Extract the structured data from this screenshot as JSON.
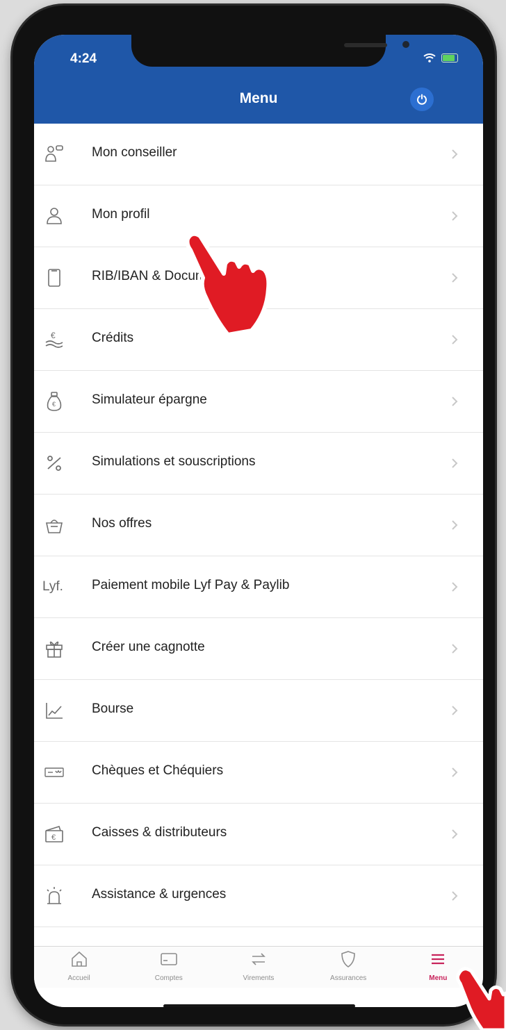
{
  "status_bar": {
    "time": "4:24"
  },
  "header": {
    "title": "Menu"
  },
  "menu_items": [
    {
      "label": "Mon conseiller",
      "icon": "advisor-icon"
    },
    {
      "label": "Mon profil",
      "icon": "user-icon"
    },
    {
      "label": "RIB/IBAN & Documents",
      "icon": "document-icon"
    },
    {
      "label": "Crédits",
      "icon": "credit-icon"
    },
    {
      "label": "Simulateur épargne",
      "icon": "savings-bag-icon"
    },
    {
      "label": "Simulations et souscriptions",
      "icon": "percent-icon"
    },
    {
      "label": "Nos offres",
      "icon": "basket-icon"
    },
    {
      "label": "Paiement mobile Lyf Pay & Paylib",
      "icon": "lyf-logo-icon",
      "icon_text": "Lyf."
    },
    {
      "label": "Créer une cagnotte",
      "icon": "gift-icon"
    },
    {
      "label": "Bourse",
      "icon": "stock-chart-icon"
    },
    {
      "label": "Chèques et Chéquiers",
      "icon": "cheque-icon"
    },
    {
      "label": "Caisses & distributeurs",
      "icon": "atm-icon"
    },
    {
      "label": "Assistance & urgences",
      "icon": "alarm-icon"
    }
  ],
  "tab_bar": [
    {
      "label": "Accueil",
      "icon": "home-icon"
    },
    {
      "label": "Comptes",
      "icon": "accounts-card-icon"
    },
    {
      "label": "Virements",
      "icon": "transfer-arrows-icon"
    },
    {
      "label": "Assurances",
      "icon": "shield-icon"
    },
    {
      "label": "Menu",
      "icon": "hamburger-icon",
      "active": true
    }
  ],
  "colors": {
    "header": "#1f57a8",
    "active_tab": "#c8235b",
    "pointer_hand": "#e01b24"
  }
}
